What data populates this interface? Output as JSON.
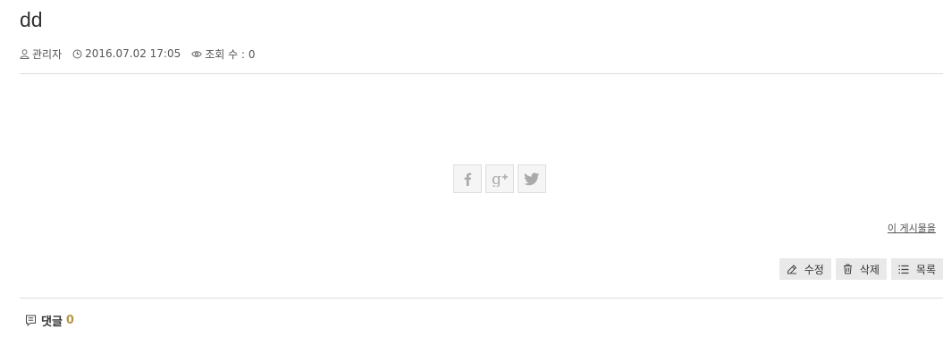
{
  "post": {
    "title": "dd",
    "author_icon": "user-icon",
    "author": "관리자",
    "date_icon": "clock-icon",
    "date": "2016.07.02 17:05",
    "views_icon": "eye-icon",
    "views": "조회 수 : 0"
  },
  "share": {
    "buttons": [
      {
        "icon": "facebook-icon"
      },
      {
        "icon": "google-plus-icon"
      },
      {
        "icon": "twitter-icon"
      }
    ],
    "link_label": "이 게시물을"
  },
  "actions": {
    "edit_label": "수정",
    "delete_label": "삭제",
    "list_label": "목록"
  },
  "comments": {
    "label": "댓글",
    "count": "0",
    "count_color": "#b8964a"
  }
}
